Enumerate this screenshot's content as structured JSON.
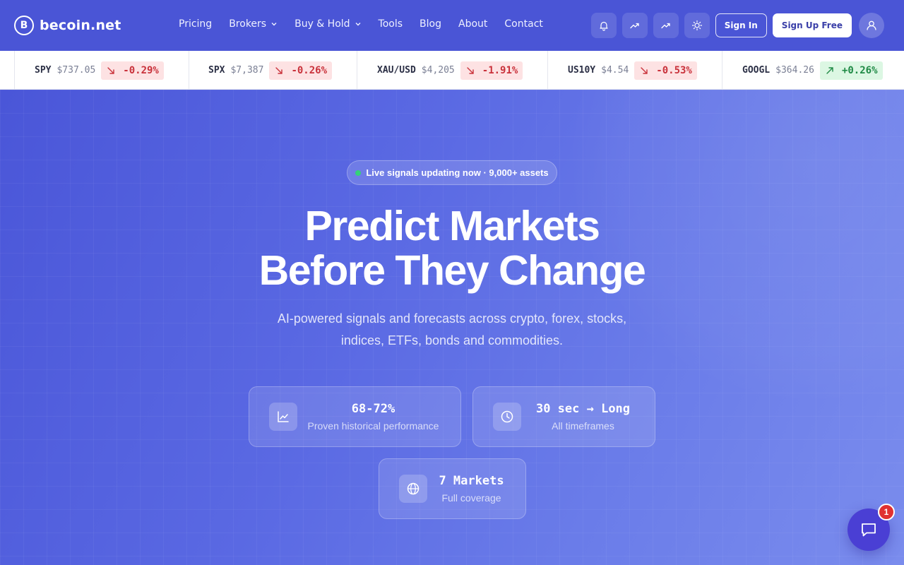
{
  "brand": {
    "logo_letter": "B",
    "name": "becoin.net"
  },
  "nav": {
    "items": [
      {
        "label": "Pricing",
        "has_dropdown": false
      },
      {
        "label": "Brokers",
        "has_dropdown": true
      },
      {
        "label": "Buy & Hold",
        "has_dropdown": true
      },
      {
        "label": "Tools",
        "has_dropdown": false
      },
      {
        "label": "Blog",
        "has_dropdown": false
      },
      {
        "label": "About",
        "has_dropdown": false
      },
      {
        "label": "Contact",
        "has_dropdown": false
      }
    ]
  },
  "header_actions": {
    "icons": [
      "bell-icon",
      "trending-up-icon",
      "trending-up-icon",
      "sun-icon"
    ],
    "sign_in": "Sign In",
    "sign_up": "Sign Up Free"
  },
  "ticker": [
    {
      "symbol": "SPY",
      "price": "$737.05",
      "change": "-0.29%",
      "direction": "down"
    },
    {
      "symbol": "SPX",
      "price": "$7,387",
      "change": "-0.26%",
      "direction": "down"
    },
    {
      "symbol": "XAU/USD",
      "price": "$4,205",
      "change": "-1.91%",
      "direction": "down"
    },
    {
      "symbol": "US10Y",
      "price": "$4.54",
      "change": "-0.53%",
      "direction": "down"
    },
    {
      "symbol": "GOOGL",
      "price": "$364.26",
      "change": "+0.26%",
      "direction": "up"
    }
  ],
  "hero": {
    "live_badge": "Live signals updating now · 9,000+ assets",
    "title_line1": "Predict Markets",
    "title_line2": "Before They Change",
    "subtitle_line1": "AI-powered signals and forecasts across crypto, forex, stocks,",
    "subtitle_line2": "indices, ETFs, bonds and commodities."
  },
  "stats": [
    {
      "value": "68-72%",
      "label": "Proven historical performance",
      "icon": "chart-line-icon"
    },
    {
      "value": "30 sec → Long",
      "label": "All timeframes",
      "icon": "clock-icon"
    },
    {
      "value": "7 Markets",
      "label": "Full coverage",
      "icon": "globe-icon"
    }
  ],
  "chat": {
    "badge_count": "1"
  },
  "colors": {
    "header_bg": "#4a55d6",
    "hero_gradient_start": "#4a56d8",
    "hero_gradient_end": "#7a8ced",
    "down_bg": "#fde2e3",
    "down_text": "#c9323b",
    "up_bg": "#dcf7e3",
    "up_text": "#1f8a45",
    "live_dot": "#34d07a",
    "chat_bg": "#4a3fd4",
    "badge_bg": "#e03131"
  }
}
